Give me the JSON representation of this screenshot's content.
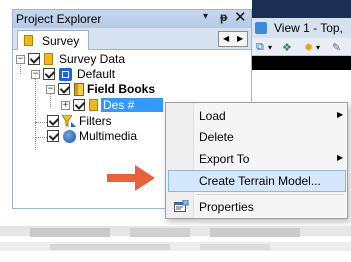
{
  "explorer": {
    "title": "Project Explorer",
    "pin_glyph": "▾",
    "float_glyph": "ᛜ",
    "close_glyph": "✕",
    "tab": {
      "label": "Survey"
    },
    "nav": {
      "left": "◀",
      "right": "▶"
    }
  },
  "tree": {
    "survey_data": "Survey Data",
    "default": "Default",
    "field_books": "Field Books",
    "des": "Des #",
    "filters": "Filters",
    "multimedia": "Multimedia"
  },
  "view": {
    "tab_label": "View 1 - Top,"
  },
  "context_menu": {
    "items": [
      {
        "label": "Load",
        "has_submenu": true
      },
      {
        "label": "Delete",
        "has_submenu": false
      },
      {
        "label": "Export To",
        "has_submenu": true
      },
      {
        "label": "Create Terrain Model...",
        "has_submenu": false,
        "highlighted": true
      },
      {
        "label": "Properties",
        "has_submenu": false
      }
    ],
    "submenu_arrow": "▶"
  },
  "colors": {
    "selection": "#3399ff",
    "menu_highlight": "#d5e7fb",
    "arrow": "#e8613a",
    "panel_header": "#c6d7ee"
  }
}
